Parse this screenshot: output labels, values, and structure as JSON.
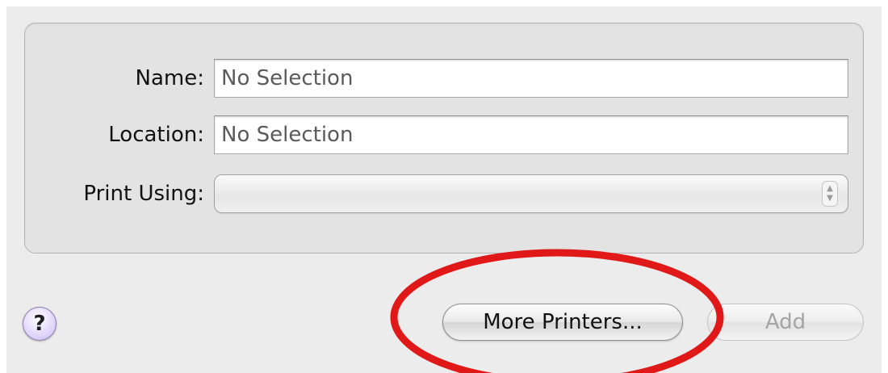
{
  "form": {
    "name_label": "Name:",
    "name_value": "No Selection",
    "location_label": "Location:",
    "location_value": "No Selection",
    "print_using_label": "Print Using:",
    "print_using_value": ""
  },
  "buttons": {
    "help_label": "?",
    "more_printers_label": "More Printers...",
    "add_label": "Add",
    "add_enabled": false
  },
  "icons": {
    "popup_arrows": "up-down-arrows-icon",
    "popup_up_glyph": "▲",
    "popup_down_glyph": "▼"
  },
  "colors": {
    "highlight_oval": "#e01818",
    "help_button": "#cbbaf0",
    "disabled_text": "#a4a4a4"
  }
}
